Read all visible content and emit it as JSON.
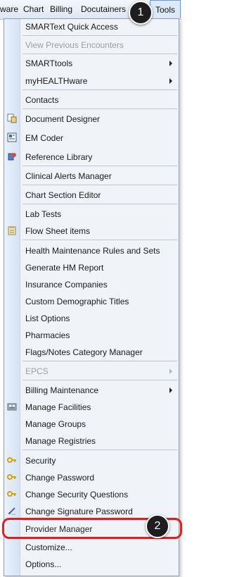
{
  "menubar": {
    "items": [
      {
        "label": "ware"
      },
      {
        "label": "Chart"
      },
      {
        "label": "Billing"
      },
      {
        "label": "Docutainers"
      },
      {
        "label": "Tools"
      }
    ]
  },
  "menu": {
    "items": [
      {
        "label": "SMARText Quick Access"
      },
      {
        "label": "View Previous Encounters"
      },
      {
        "label": "SMARTtools"
      },
      {
        "label": "myHEALTHware"
      },
      {
        "label": "Contacts"
      },
      {
        "label": "Document Designer",
        "icon": "document-designer-icon"
      },
      {
        "label": "EM Coder",
        "icon": "em-coder-icon"
      },
      {
        "label": "Reference Library",
        "icon": "reference-library-icon"
      },
      {
        "label": "Clinical Alerts Manager"
      },
      {
        "label": "Chart Section Editor"
      },
      {
        "label": "Lab Tests"
      },
      {
        "label": "Flow Sheet items",
        "icon": "clipboard-icon"
      },
      {
        "label": "Health Maintenance Rules and Sets"
      },
      {
        "label": "Generate HM Report"
      },
      {
        "label": "Insurance Companies"
      },
      {
        "label": "Custom Demographic Titles"
      },
      {
        "label": "List Options"
      },
      {
        "label": "Pharmacies"
      },
      {
        "label": "Flags/Notes Category Manager"
      },
      {
        "label": "EPCS"
      },
      {
        "label": "Billing Maintenance"
      },
      {
        "label": "Manage Facilities",
        "icon": "facilities-icon"
      },
      {
        "label": "Manage Groups"
      },
      {
        "label": "Manage Registries"
      },
      {
        "label": "Security",
        "icon": "key-icon"
      },
      {
        "label": "Change Password",
        "icon": "key-icon"
      },
      {
        "label": "Change Security Questions",
        "icon": "key-icon"
      },
      {
        "label": "Change Signature Password",
        "icon": "pen-icon"
      },
      {
        "label": "Provider Manager"
      },
      {
        "label": "Customize..."
      },
      {
        "label": "Options..."
      }
    ]
  },
  "callouts": {
    "first": "1",
    "second": "2"
  },
  "colors": {
    "highlight": "#e02020",
    "callout_bg": "#1e1e1e",
    "menu_bg": "#f0f3f7"
  }
}
